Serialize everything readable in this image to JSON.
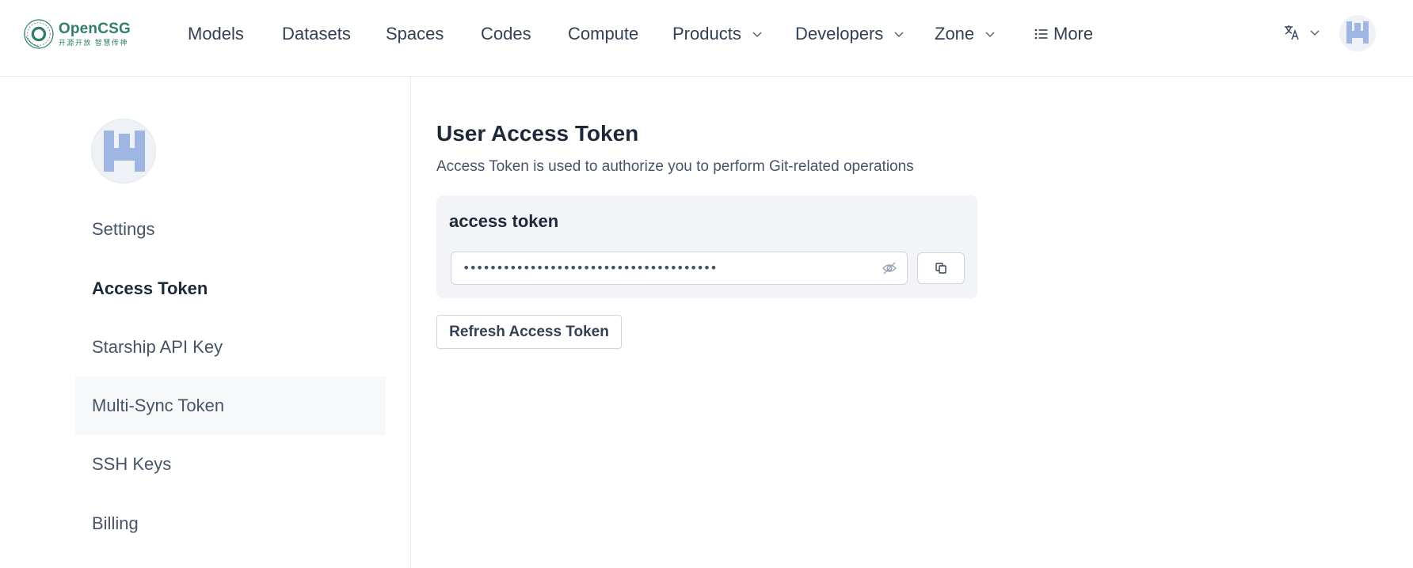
{
  "app": {
    "logo_name": "OpenCSG",
    "logo_sub": "开源开放 智慧传神"
  },
  "nav": {
    "items": [
      {
        "label": "Models"
      },
      {
        "label": "Datasets"
      },
      {
        "label": "Spaces"
      },
      {
        "label": "Codes"
      },
      {
        "label": "Compute"
      },
      {
        "label": "Products",
        "icon": "chevron-down-icon"
      },
      {
        "label": "Developers",
        "icon": "chevron-down-icon"
      },
      {
        "label": "Zone",
        "icon": "chevron-down-icon"
      },
      {
        "label": "More",
        "icon": "list-icon"
      }
    ],
    "language_icon": "translate-icon"
  },
  "sidebar": {
    "items": [
      {
        "label": "Settings"
      },
      {
        "label": "Access Token",
        "state": "active"
      },
      {
        "label": "Starship API Key"
      },
      {
        "label": "Multi-Sync Token",
        "state": "hover"
      },
      {
        "label": "SSH Keys"
      },
      {
        "label": "Billing"
      }
    ]
  },
  "main": {
    "title": "User Access Token",
    "description": "Access Token is used to authorize you to perform Git-related operations",
    "token_label": "access token",
    "token_value": "••••••••••••••••••••••••••••••••••••••",
    "eye_icon": "eye-off-icon",
    "copy_icon": "copy-icon",
    "refresh_label": "Refresh Access Token"
  },
  "colors": {
    "brand": "#2f7d6a",
    "avatar_fill": "#9fb6e3"
  }
}
